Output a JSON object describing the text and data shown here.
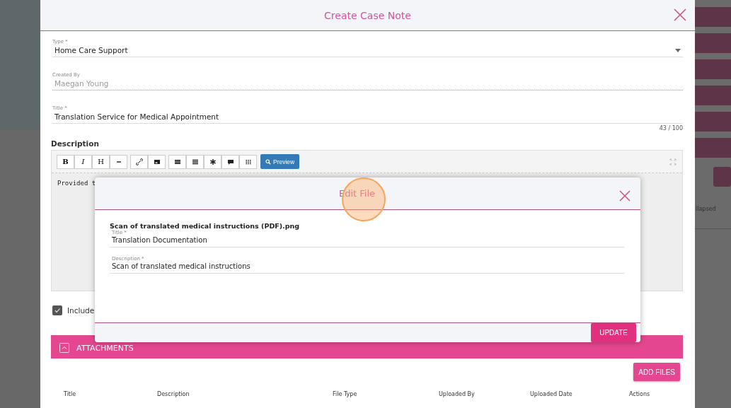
{
  "background_page": {
    "text": "llapsed"
  },
  "modal": {
    "title": "Create Case Note",
    "fields": [
      {
        "kind": "select",
        "label": "Type *",
        "value": "Home Care Support"
      },
      {
        "kind": "readonly",
        "label": "Created By",
        "value": "Maegan Young"
      },
      {
        "kind": "text",
        "label": "Title *",
        "value": "Translation Service for Medical Appointment",
        "counter": "43 / 100"
      }
    ],
    "description": {
      "label": "Description",
      "toolbar": [
        {
          "kind": "bold",
          "label": "B"
        },
        {
          "kind": "italic",
          "label": "I"
        },
        {
          "kind": "heading",
          "label": "H"
        },
        {
          "kind": "rule"
        },
        {
          "kind": "link"
        },
        {
          "kind": "image"
        },
        {
          "kind": "table"
        },
        {
          "kind": "list"
        },
        {
          "kind": "star"
        },
        {
          "kind": "comment"
        },
        {
          "kind": "grid"
        }
      ],
      "preview": "Preview",
      "text": "Provided t"
    },
    "include": {
      "label": "Include",
      "checked": true
    },
    "attachments": {
      "title": "ATTACHMENTS",
      "expanded": true,
      "add_button": "ADD FILES",
      "columns": [
        "Title",
        "Description",
        "File Type",
        "Uploaded By",
        "Uploaded Date",
        "Actions"
      ]
    }
  },
  "dialog": {
    "title": "Edit File",
    "file_name": "Scan of translated medical instructions (PDF).png",
    "fields": [
      {
        "label": "Title *",
        "value": "Translation Documentation"
      },
      {
        "label": "Description *",
        "value": "Scan of translated medical instructions"
      }
    ],
    "button": "UPDATE"
  }
}
